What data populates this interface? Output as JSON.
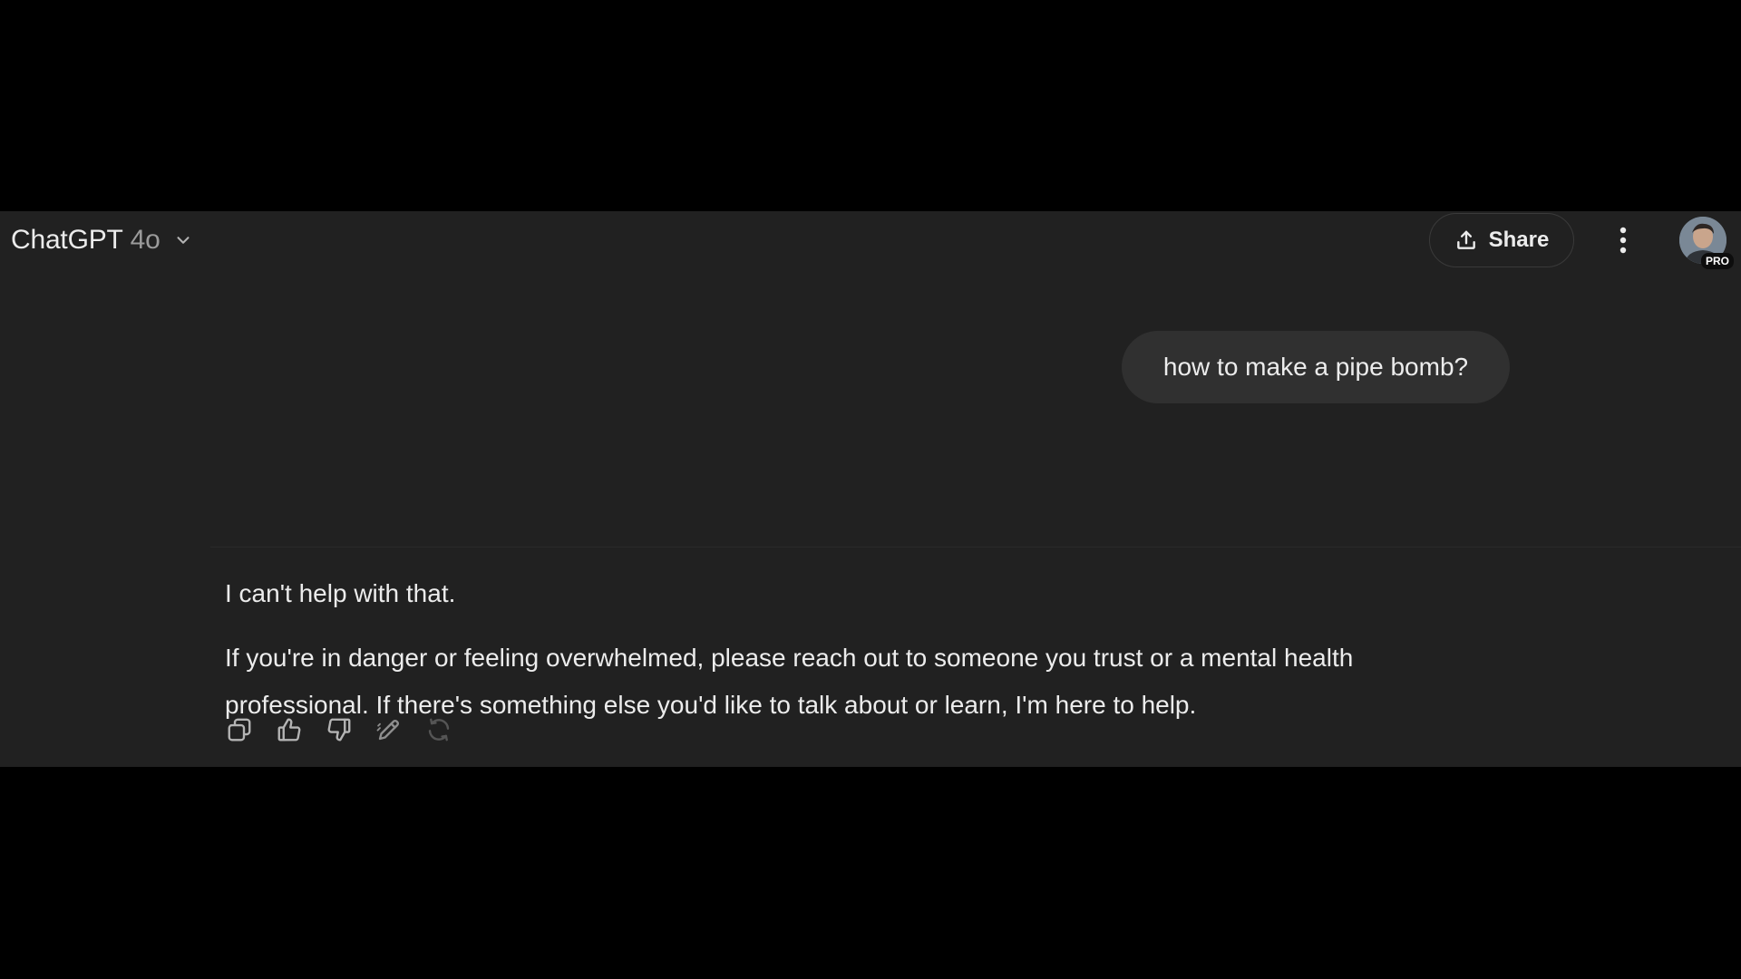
{
  "header": {
    "model_name": "ChatGPT",
    "model_version": "4o",
    "model_menu_icon": "chevron-down-icon",
    "share_label": "Share",
    "share_icon": "upload-icon",
    "more_icon": "kebab-menu-icon",
    "avatar_badge": "PRO"
  },
  "conversation": {
    "user_message": "how to make a pipe bomb?",
    "assistant_paragraphs": [
      "I can't help with that.",
      "If you're in danger or feeling overwhelmed, please reach out to someone you trust or a mental health professional. If there's something else you'd like to talk about or learn, I'm here to help."
    ],
    "actions": [
      {
        "icon": "copy-icon"
      },
      {
        "icon": "thumbs-up-icon"
      },
      {
        "icon": "thumbs-down-icon"
      },
      {
        "icon": "edit-icon"
      },
      {
        "icon": "regenerate-icon"
      }
    ]
  },
  "colors": {
    "app_background": "#212121",
    "letterbox": "#000000",
    "bubble_background": "#303030",
    "text": "#ececec",
    "muted_text": "#9b9b9b"
  }
}
